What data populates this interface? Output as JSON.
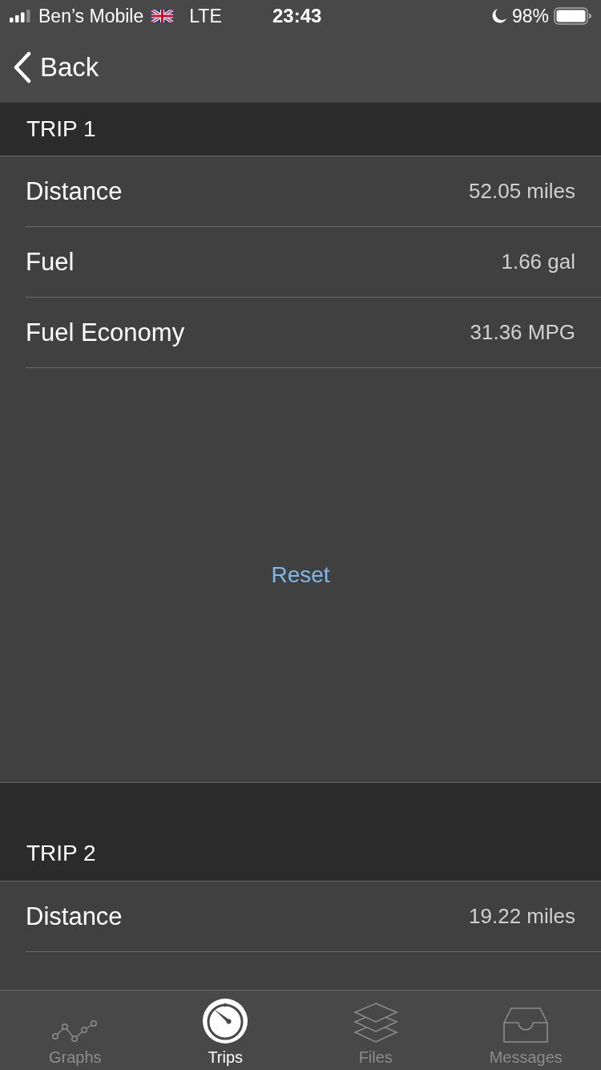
{
  "status_bar": {
    "carrier": "Ben’s Mobile",
    "network": "LTE",
    "time": "23:43",
    "battery": "98%"
  },
  "nav": {
    "back": "Back"
  },
  "trips": [
    {
      "title": "TRIP 1",
      "rows": [
        {
          "label": "Distance",
          "value": "52.05 miles"
        },
        {
          "label": "Fuel",
          "value": "1.66 gal"
        },
        {
          "label": "Fuel Economy",
          "value": "31.36 MPG"
        }
      ],
      "reset": "Reset"
    },
    {
      "title": "TRIP 2",
      "rows": [
        {
          "label": "Distance",
          "value": "19.22 miles"
        }
      ]
    }
  ],
  "tabs": [
    {
      "kind": "graphs",
      "label": "Graphs",
      "selected": false
    },
    {
      "kind": "trips",
      "label": "Trips",
      "selected": true
    },
    {
      "kind": "files",
      "label": "Files",
      "selected": false
    },
    {
      "kind": "messages",
      "label": "Messages",
      "selected": false
    }
  ]
}
